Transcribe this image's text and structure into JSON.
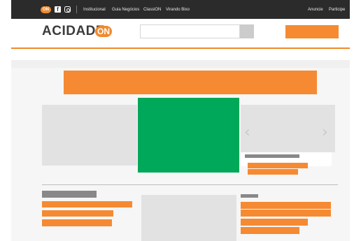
{
  "topbar": {
    "brand_badge": "ON",
    "social": {
      "facebook": "f",
      "instagram_icon": "instagram-icon"
    },
    "nav": [
      {
        "label": "Institucional"
      },
      {
        "label": "Guia Negócios"
      },
      {
        "label": "ClassiON"
      },
      {
        "label": "Virando Bixo"
      }
    ],
    "right_links": [
      {
        "label": "Anuncie"
      },
      {
        "label": "Participe"
      }
    ]
  },
  "header": {
    "logo_text": "ACIDADE",
    "logo_badge": "ON",
    "search": {
      "value": "",
      "placeholder": ""
    }
  },
  "carousel": {
    "prev": "‹",
    "next": "›"
  },
  "colors": {
    "brand_orange": "#f58a33",
    "featured_green": "#00a859",
    "placeholder_gray": "#e2e2e2",
    "topbar_dark": "#2b2b2b"
  }
}
